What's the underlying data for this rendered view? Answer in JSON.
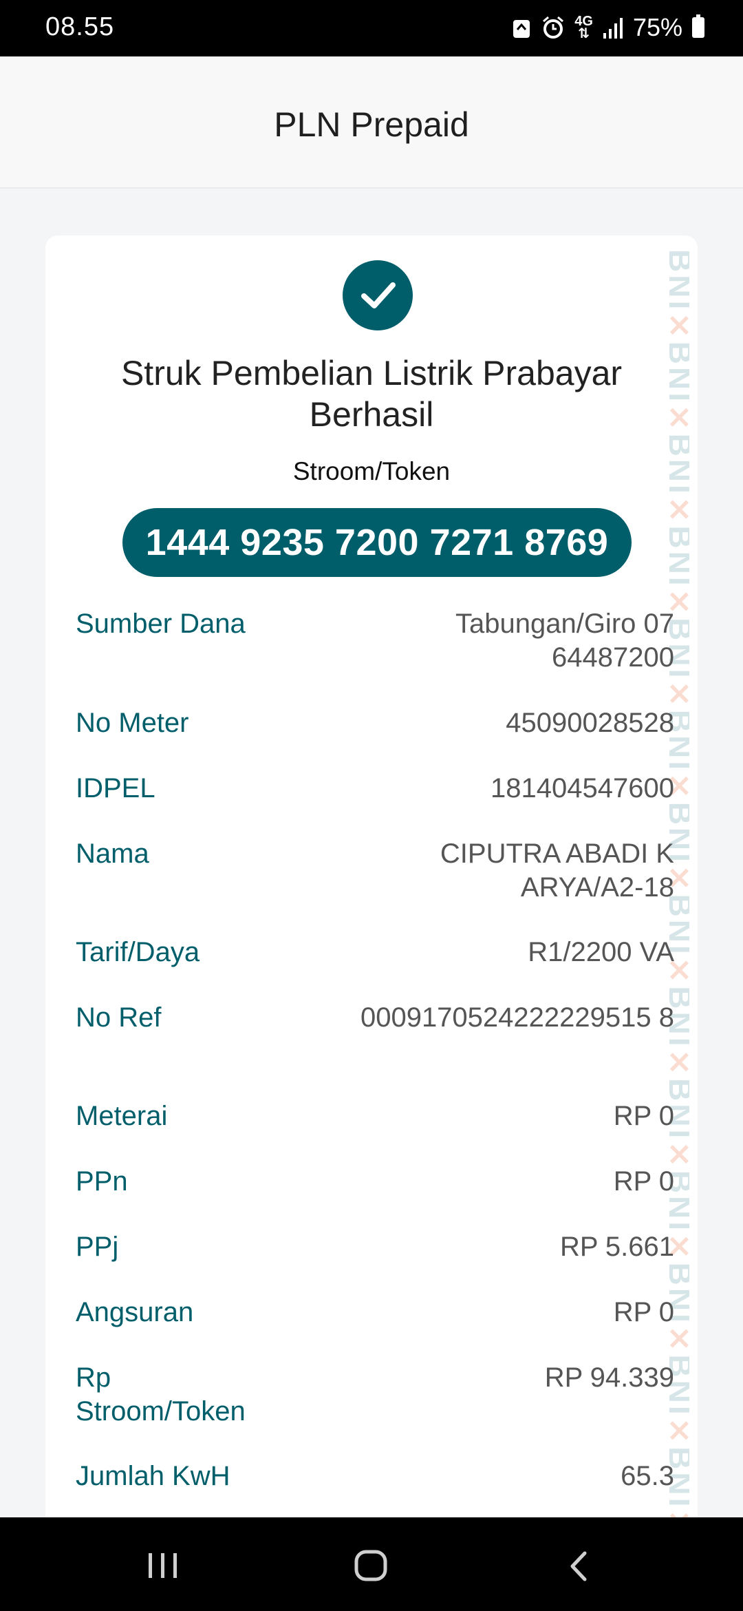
{
  "status_bar": {
    "time": "08.55",
    "network": "4G",
    "battery": "75%"
  },
  "app_bar": {
    "title": "PLN Prepaid"
  },
  "receipt": {
    "title": "Struk Pembelian Listrik Prabayar Berhasil",
    "token_label": "Stroom/Token",
    "token": "1444 9235 7200 7271 8769",
    "watermark": "BNI",
    "rows": [
      {
        "label": "Sumber Dana",
        "value": "Tabungan/Giro 0764487200"
      },
      {
        "label": "No Meter",
        "value": "45090028528"
      },
      {
        "label": "IDPEL",
        "value": "181404547600"
      },
      {
        "label": "Nama",
        "value": "CIPUTRA ABADI KARYA/A2-18"
      },
      {
        "label": "Tarif/Daya",
        "value": "R1/2200 VA"
      },
      {
        "label": "No Ref",
        "value": "0009170524222229515 8"
      },
      {
        "label": "Meterai",
        "value": "RP 0"
      },
      {
        "label": "PPn",
        "value": "RP 0"
      },
      {
        "label": "PPj",
        "value": "RP 5.661"
      },
      {
        "label": "Angsuran",
        "value": "RP 0"
      },
      {
        "label": "Rp Stroom/Token",
        "value": "RP 94.339"
      },
      {
        "label": "Jumlah KwH",
        "value": "65.3"
      }
    ]
  },
  "colors": {
    "accent": "#005e6a",
    "label": "#005e6a",
    "value": "#555555",
    "watermark_orange": "#e8602c"
  },
  "icons": {
    "success": "check-icon",
    "nav_recent": "recent-apps-icon",
    "nav_home": "home-icon",
    "nav_back": "back-icon"
  }
}
